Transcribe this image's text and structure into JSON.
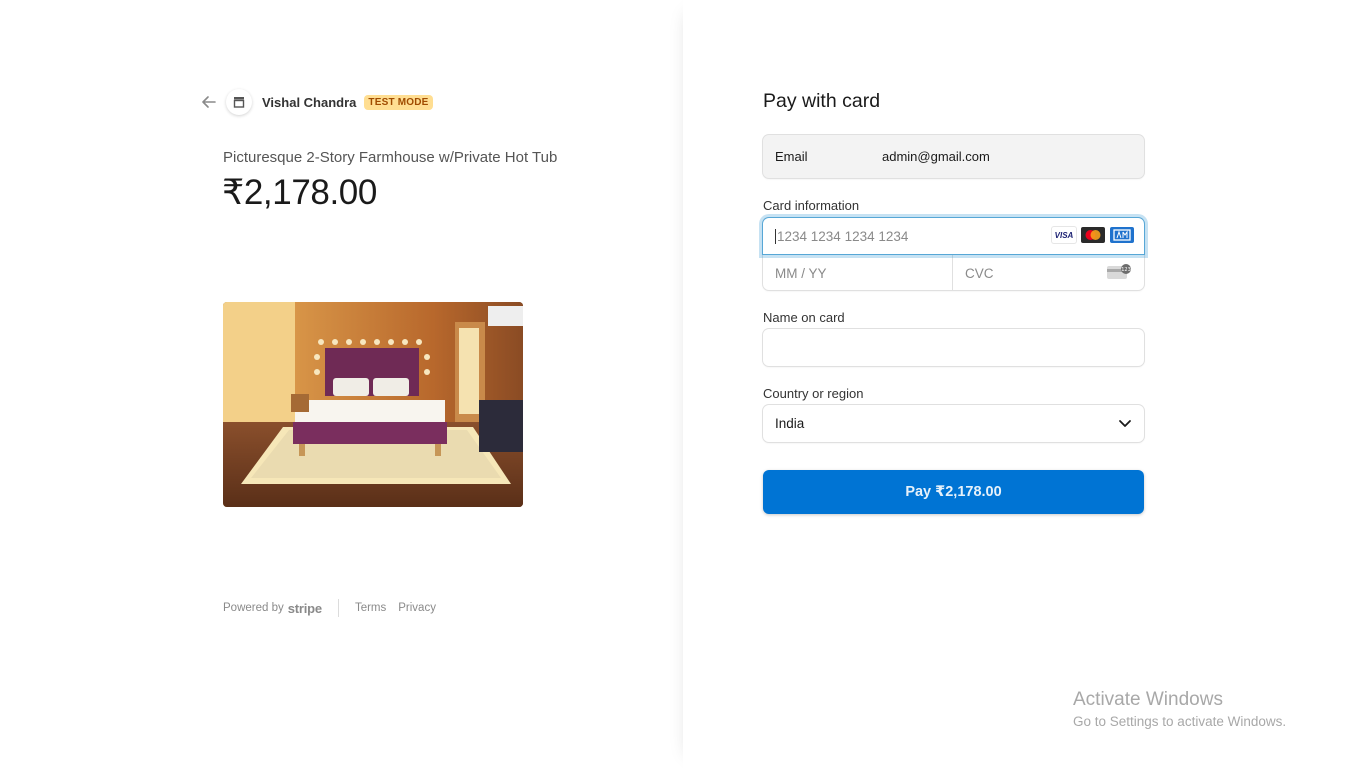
{
  "merchant": {
    "name": "Vishal Chandra",
    "badge": "TEST MODE",
    "icons": {
      "back": "arrow-left-icon",
      "store": "store-icon"
    }
  },
  "product": {
    "name": "Picturesque 2-Story Farmhouse w/Private Hot Tub",
    "price": "₹2,178.00",
    "image": "bedroom-photo"
  },
  "footer": {
    "powered_by": "Powered by",
    "stripe": "stripe",
    "links": [
      "Terms",
      "Privacy"
    ]
  },
  "form": {
    "title": "Pay with card",
    "email": {
      "label": "Email",
      "value": "admin@gmail.com"
    },
    "card": {
      "label": "Card information",
      "number_placeholder": "1234 1234 1234 1234",
      "expiry_placeholder": "MM / YY",
      "cvc_placeholder": "CVC",
      "brands": [
        "visa-icon",
        "mastercard-icon",
        "amex-icon"
      ],
      "visa_text": "VISA"
    },
    "name_on_card": {
      "label": "Name on card",
      "value": ""
    },
    "country": {
      "label": "Country or region",
      "selected": "India"
    },
    "pay_button": "Pay ₹2,178.00"
  },
  "watermark": {
    "title": "Activate Windows",
    "subtitle": "Go to Settings to activate Windows."
  },
  "colors": {
    "primary": "#0074d4",
    "badge_bg": "#ffde92",
    "badge_text": "#a04b00"
  }
}
